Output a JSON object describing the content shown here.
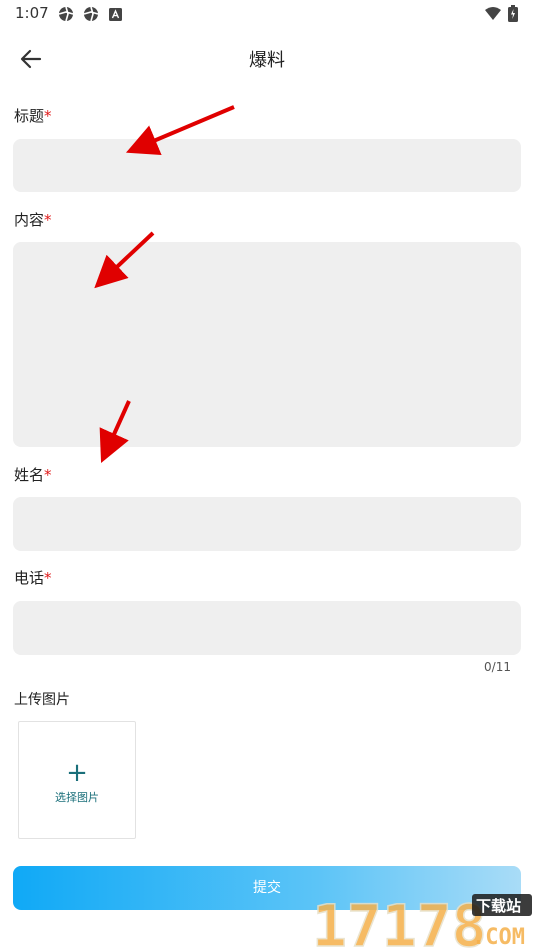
{
  "status_bar": {
    "time": "1:07"
  },
  "header": {
    "title": "爆料"
  },
  "form": {
    "title_label": "标题",
    "content_label": "内容",
    "name_label": "姓名",
    "phone_label": "电话",
    "required_mark": "*",
    "phone_counter": "0/11",
    "upload_label": "上传图片",
    "upload_button_text": "选择图片",
    "upload_plus": "+",
    "submit_label": "提交"
  },
  "watermark": {
    "number": "17178",
    "tag": "下载站",
    "domain": ".COM"
  },
  "colors": {
    "required": "#e01b1b",
    "input_bg": "#efefef",
    "submit_start": "#10a9f6",
    "submit_end": "#a9dcf7",
    "arrow": "#e00000"
  },
  "icons": {
    "back": "arrow-left-icon",
    "wifi": "wifi-icon",
    "battery": "battery-icon",
    "status1": "aperture-icon",
    "status2": "aperture-icon",
    "status3": "a-box-icon"
  }
}
